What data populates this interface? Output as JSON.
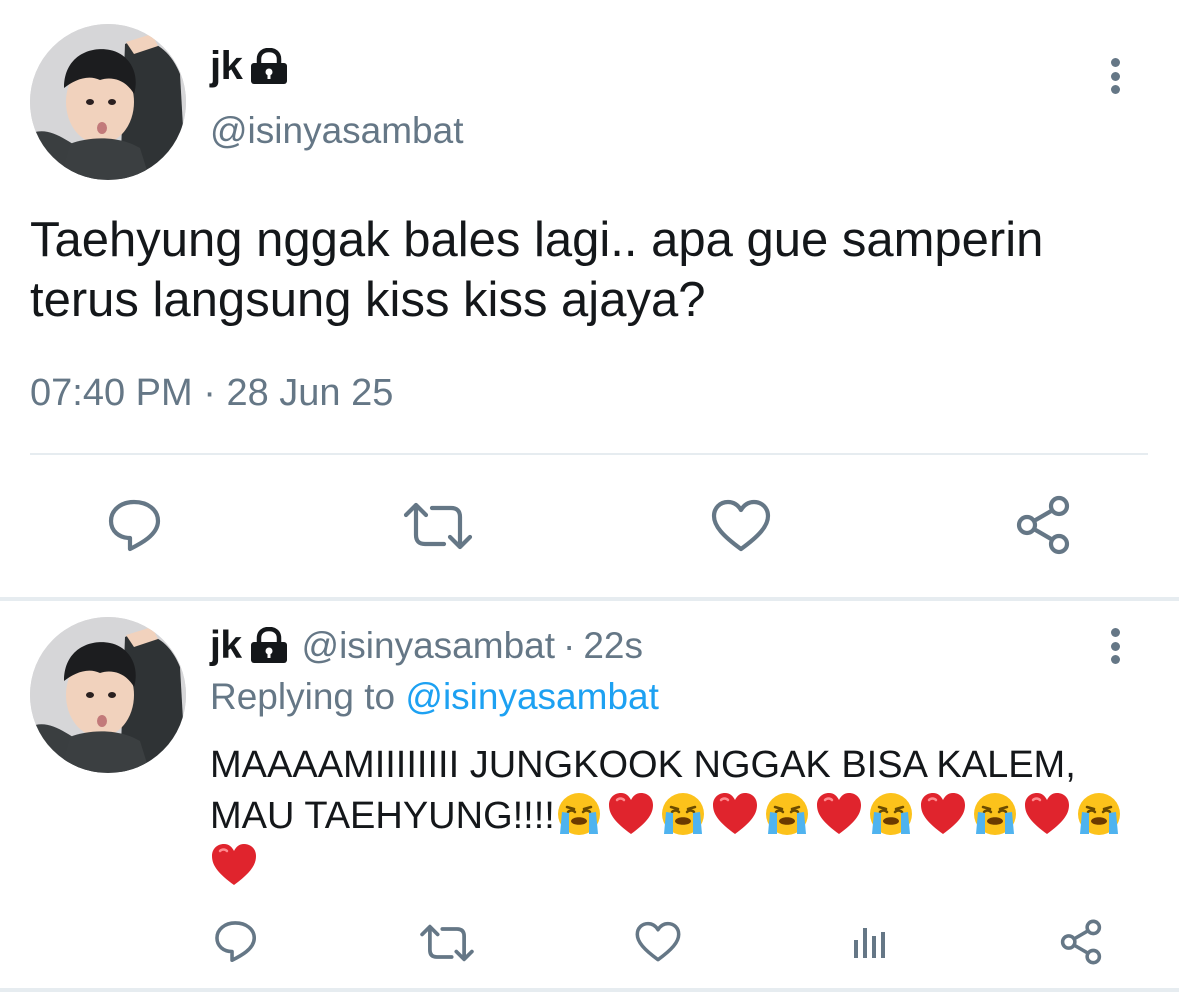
{
  "main_tweet": {
    "display_name": "jk",
    "handle": "@isinyasambat",
    "text": "Taehyung nggak bales lagi.. apa gue samperin terus langsung kiss kiss ajaya?",
    "time": "07:40 PM",
    "separator": "·",
    "date": "28 Jun 25",
    "protected_icon": "lock-icon",
    "actions": [
      "reply-icon",
      "retweet-icon",
      "like-icon",
      "share-icon"
    ]
  },
  "reply_tweet": {
    "display_name": "jk",
    "handle": "@isinyasambat",
    "separator": "·",
    "time": "22s",
    "replying_prefix": "Replying to",
    "replying_to": "@isinyasambat",
    "text": "MAAAAMIIIIIIII JUNGKOOK NGGAK BISA KALEM, MAU TAEHYUNG!!!!",
    "emojis": [
      "crying-face",
      "red-heart",
      "crying-face",
      "red-heart",
      "crying-face",
      "red-heart",
      "crying-face",
      "red-heart",
      "crying-face",
      "red-heart",
      "crying-face",
      "red-heart"
    ],
    "actions": [
      "reply-icon",
      "retweet-icon",
      "like-icon",
      "analytics-icon",
      "share-icon"
    ]
  },
  "colors": {
    "text_primary": "#14171a",
    "text_secondary": "#657786",
    "link": "#1da1f2",
    "divider": "#e6ecf0",
    "icon": "#657786"
  }
}
